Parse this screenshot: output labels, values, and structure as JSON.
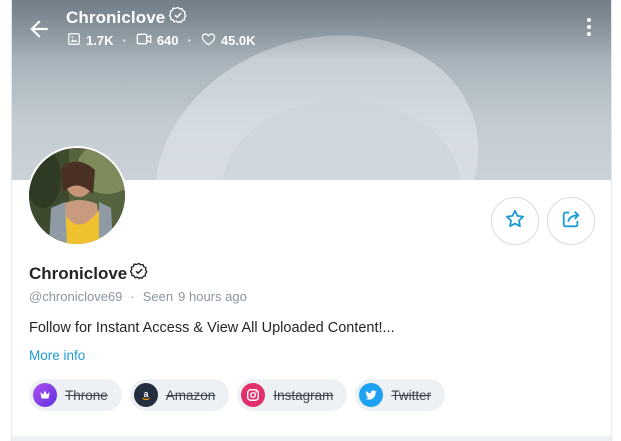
{
  "profile": {
    "name": "Chroniclove",
    "handle": "@chroniclove69",
    "seen_label": "Seen",
    "seen_time": "9 hours ago",
    "bio": "Follow for Instant Access & View All Uploaded Content!...",
    "more_info": "More info",
    "verified_icon": "verified-badge-icon"
  },
  "header": {
    "title": "Chroniclove",
    "stats": {
      "photos": "1.7K",
      "videos": "640",
      "likes": "45.0K"
    }
  },
  "links": [
    {
      "label": "Throne",
      "icon": "throne-icon",
      "color": "#7b3fe4"
    },
    {
      "label": "Amazon",
      "icon": "amazon-icon",
      "color": "#232f3e"
    },
    {
      "label": "Instagram",
      "icon": "instagram-icon",
      "color": "#e1306c"
    },
    {
      "label": "Twitter",
      "icon": "twitter-icon",
      "color": "#1da1f2"
    }
  ],
  "colors": {
    "accent": "#1f9bd6",
    "text": "#242529",
    "muted": "#8a96a3"
  }
}
